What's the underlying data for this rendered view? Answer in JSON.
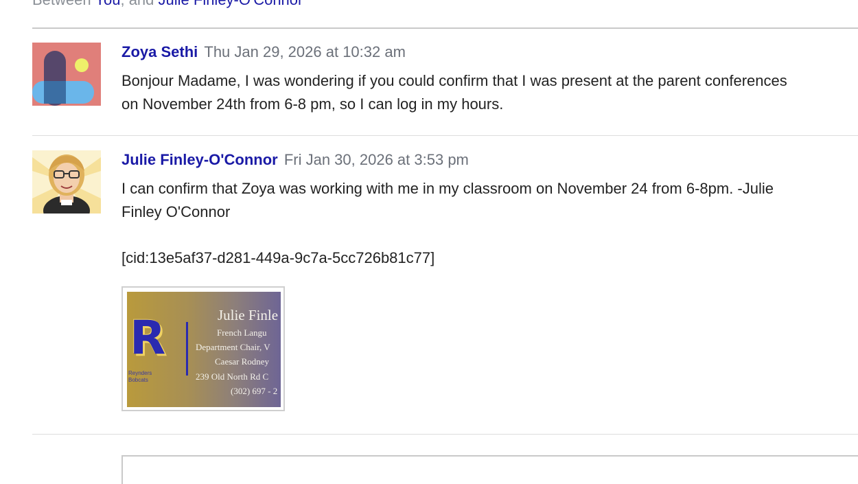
{
  "thread": {
    "between_prefix": "Between ",
    "between_you": "You",
    "between_sep": ", and ",
    "between_other": "Julie Finley-O'Connor"
  },
  "messages": [
    {
      "author": "Zoya Sethi",
      "timestamp": "Thu Jan 29, 2026 at 10:32 am",
      "body": "Bonjour Madame, I was wondering if you could confirm that I was present at the parent conferences on November 24th from 6-8 pm, so I can log in my hours."
    },
    {
      "author": "Julie Finley-O'Connor",
      "timestamp": "Fri Jan 30, 2026 at 3:53 pm",
      "body": "I can confirm that Zoya was working with me in my classroom on November 24 from 6-8pm. -Julie Finley O'Connor",
      "cid": "[cid:13e5af37-d281-449a-9c7a-5cc726b81c77]",
      "signature": {
        "logo_letter": "R",
        "name": "Julie Finle",
        "line1": "French Langu",
        "line2": "Department Chair, V",
        "line3": "Caesar Rodney",
        "line4": "239 Old North Rd C",
        "line5": "(302) 697 - 2",
        "tiny1": "Reynders",
        "tiny2": "Bobcats"
      }
    }
  ],
  "colors": {
    "link": "#1a1aa6",
    "meta": "#6b7079",
    "text": "#222222"
  }
}
